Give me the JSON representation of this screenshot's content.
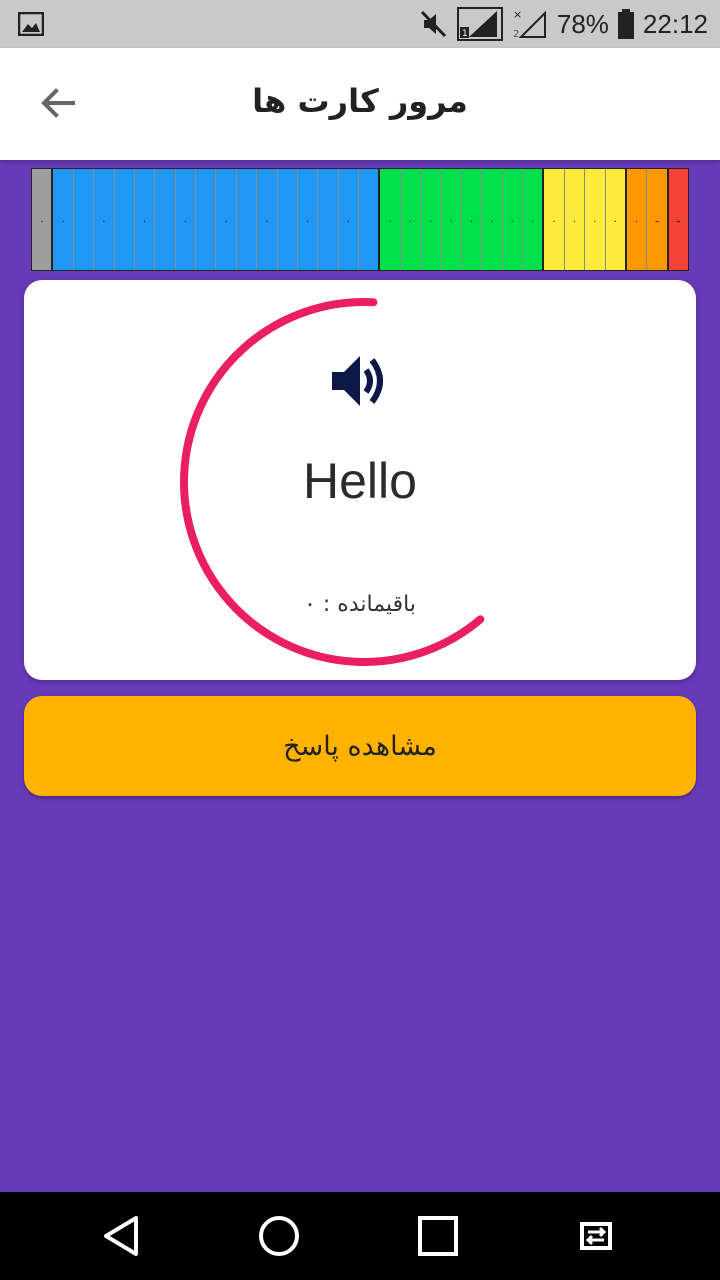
{
  "status_bar": {
    "battery": "78%",
    "time": "22:12",
    "sim1": "1",
    "sim2": "2",
    "icons": [
      "image-icon",
      "mute-icon",
      "signal-sim1-icon",
      "signal-sim2-icon",
      "battery-icon"
    ]
  },
  "toolbar": {
    "title": "مرور کارت ها",
    "back_icon": "arrow-back-icon"
  },
  "progress_strip": {
    "colors": {
      "gray": "#9e9e9e",
      "blue": "#2196f3",
      "green": "#00e04a",
      "yellow": "#ffeb3b",
      "orange": "#ff9800",
      "red": "#f44336"
    },
    "cells": [
      {
        "color": "gray",
        "mark": "."
      },
      {
        "color": "blue",
        "mark": "."
      },
      {
        "color": "blue",
        "mark": ""
      },
      {
        "color": "blue",
        "mark": "."
      },
      {
        "color": "blue",
        "mark": ""
      },
      {
        "color": "blue",
        "mark": "."
      },
      {
        "color": "blue",
        "mark": ""
      },
      {
        "color": "blue",
        "mark": "."
      },
      {
        "color": "blue",
        "mark": ""
      },
      {
        "color": "blue",
        "mark": "."
      },
      {
        "color": "blue",
        "mark": ""
      },
      {
        "color": "blue",
        "mark": "."
      },
      {
        "color": "blue",
        "mark": ""
      },
      {
        "color": "blue",
        "mark": "."
      },
      {
        "color": "blue",
        "mark": ""
      },
      {
        "color": "blue",
        "mark": "."
      },
      {
        "color": "blue",
        "mark": ""
      },
      {
        "color": "green",
        "mark": "."
      },
      {
        "color": "green",
        "mark": "."
      },
      {
        "color": "green",
        "mark": "."
      },
      {
        "color": "green",
        "mark": "."
      },
      {
        "color": "green",
        "mark": "."
      },
      {
        "color": "green",
        "mark": "."
      },
      {
        "color": "green",
        "mark": "."
      },
      {
        "color": "green",
        "mark": "."
      },
      {
        "color": "yellow",
        "mark": "."
      },
      {
        "color": "yellow",
        "mark": "."
      },
      {
        "color": "yellow",
        "mark": "."
      },
      {
        "color": "yellow",
        "mark": "."
      },
      {
        "color": "orange",
        "mark": "."
      },
      {
        "color": "orange",
        "mark": "ـ"
      },
      {
        "color": "red",
        "mark": "ـ"
      }
    ]
  },
  "card": {
    "word": "Hello",
    "remaining": "باقیمانده : ۰",
    "speaker_icon": "speaker-icon",
    "timer_fraction": 0.62,
    "ring_color": "#e91e63"
  },
  "answer_button": {
    "label": "مشاهده پاسخ",
    "color": "#ffb300"
  },
  "nav_bar": {
    "icons": [
      "back-triangle-icon",
      "home-circle-icon",
      "recents-square-icon",
      "switch-icon"
    ]
  }
}
